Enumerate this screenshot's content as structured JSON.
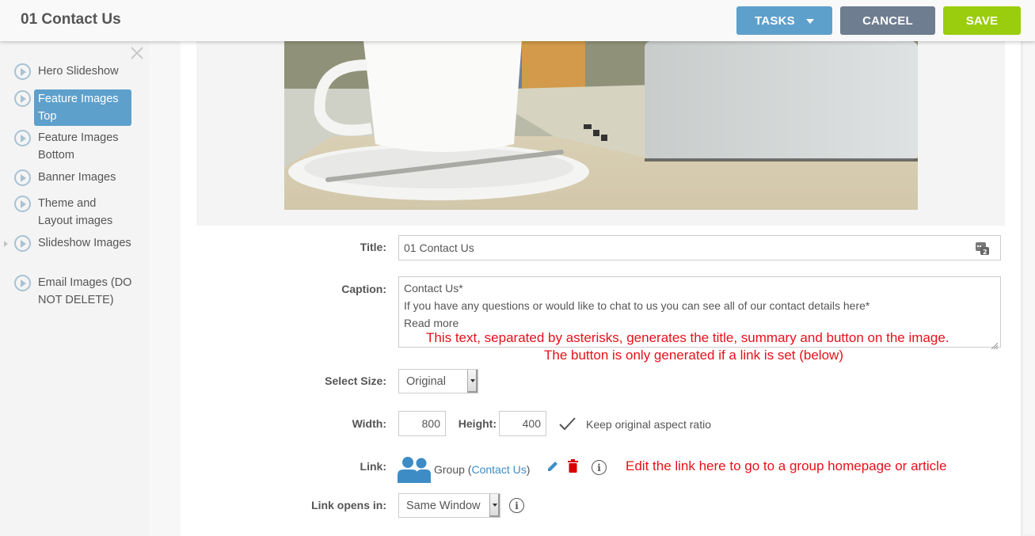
{
  "header": {
    "title": "01 Contact Us",
    "buttons": {
      "tasks": "TASKS",
      "cancel": "CANCEL",
      "save": "SAVE"
    },
    "colors": {
      "tasks": "#5ea0cc",
      "cancel": "#6f7d90",
      "save": "#9acd0e"
    }
  },
  "sidebar": {
    "items": [
      {
        "label": "Hero Slideshow",
        "selected": false
      },
      {
        "label": "Feature Images Top",
        "selected": true
      },
      {
        "label": "Feature Images Bottom",
        "selected": false
      },
      {
        "label": "Banner Images",
        "selected": false
      },
      {
        "label": "Theme and Layout images",
        "selected": false
      },
      {
        "label": "Slideshow Images",
        "selected": false,
        "expandable": true
      },
      {
        "label": "Email Images (DO NOT DELETE)",
        "selected": false
      }
    ]
  },
  "image": {
    "description": "Coffee cup on saucer with spoon next to a laptop on a wooden table"
  },
  "form": {
    "title_label": "Title:",
    "title_value": "01 Contact Us",
    "caption_label": "Caption:",
    "caption_lines": [
      "Contact Us*",
      "If you have any questions or would like to chat to us you can see all of our contact details here*",
      "Read more"
    ],
    "caption_note_1": "This text, separated by asterisks, generates the title, summary and button on the image.",
    "caption_note_2": "The button is only generated if a link is set (below)",
    "size_label": "Select Size:",
    "size_value": "Original",
    "width_label": "Width:",
    "width_value": "800",
    "height_label": "Height:",
    "height_value": "400",
    "aspect_label": "Keep original aspect ratio",
    "aspect_checked": true,
    "link_label": "Link:",
    "link_type": "Group (",
    "link_target": "Contact Us",
    "link_close": ")",
    "link_note": "Edit the link here to go to a group homepage or article",
    "opens_label": "Link opens in:",
    "opens_value": "Same Window",
    "info_glyph": "i"
  }
}
